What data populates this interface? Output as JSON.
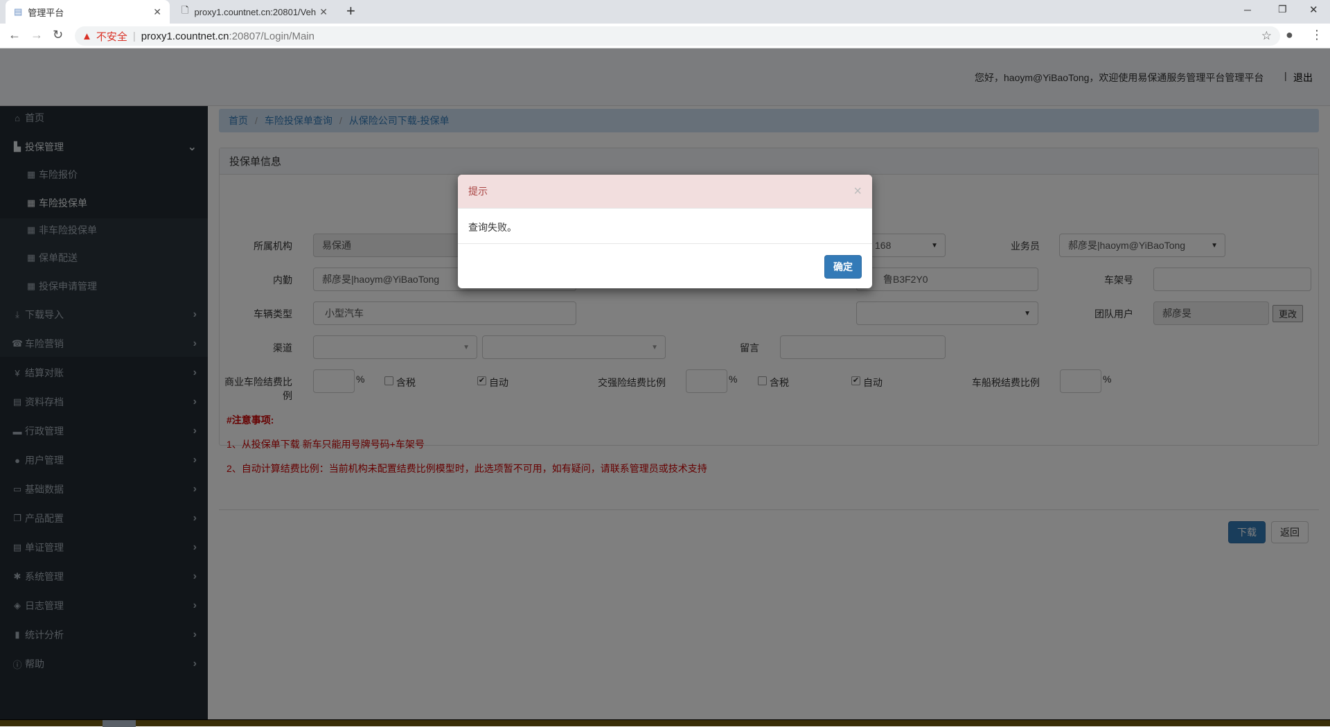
{
  "browser": {
    "tabs": [
      {
        "title": "管理平台",
        "active": true
      },
      {
        "title": "proxy1.countnet.cn:20801/Veh",
        "active": false
      }
    ],
    "security_label": "不安全",
    "url_host": "proxy1.countnet.cn",
    "url_rest": ":20807/Login/Main"
  },
  "header": {
    "welcome": "您好，haoym@YiBaoTong，欢迎使用易保通服务管理平台管理平台",
    "separator": "|",
    "logout": "退出"
  },
  "sidebar": {
    "items": [
      {
        "label": "首页",
        "icon": "home-icon"
      },
      {
        "label": "投保管理",
        "icon": "file-icon",
        "expanded": true,
        "children": [
          {
            "label": "车险报价"
          },
          {
            "label": "车险投保单",
            "active": true
          },
          {
            "label": "非车险投保单"
          },
          {
            "label": "保单配送"
          },
          {
            "label": "投保申请管理"
          }
        ]
      },
      {
        "label": "下载导入",
        "icon": "download-icon"
      },
      {
        "label": "车险营销",
        "icon": "phone-icon"
      },
      {
        "label": "结算对账",
        "icon": "yen-icon"
      },
      {
        "label": "资料存档",
        "icon": "list-icon"
      },
      {
        "label": "行政管理",
        "icon": "briefcase-icon"
      },
      {
        "label": "用户管理",
        "icon": "user-icon"
      },
      {
        "label": "基础数据",
        "icon": "hdd-icon"
      },
      {
        "label": "产品配置",
        "icon": "copy-icon"
      },
      {
        "label": "单证管理",
        "icon": "list-alt-icon"
      },
      {
        "label": "系统管理",
        "icon": "gear-icon"
      },
      {
        "label": "日志管理",
        "icon": "tags-icon"
      },
      {
        "label": "统计分析",
        "icon": "bar-chart-icon"
      },
      {
        "label": "帮助",
        "icon": "info-icon"
      }
    ]
  },
  "breadcrumb": [
    "首页",
    "车险投保单查询",
    "从保险公司下载-投保单"
  ],
  "panel": {
    "title": "投保单信息",
    "fields": {
      "org": {
        "label": "所属机构",
        "value": "易保通"
      },
      "partial_select": {
        "value": "168"
      },
      "salesman": {
        "label": "业务员",
        "value": "郝彦旻|haoym@YiBaoTong"
      },
      "internal": {
        "label": "内勤",
        "value": "郝彦旻|haoym@YiBaoTong"
      },
      "plate": {
        "value": "鲁B3F2Y0"
      },
      "vin": {
        "label": "车架号",
        "value": ""
      },
      "vehicle_type": {
        "label": "车辆类型",
        "value": "小型汽车"
      },
      "team_user": {
        "label": "团队用户",
        "value": "郝彦旻",
        "change_button": "更改"
      },
      "channel": {
        "label": "渠道",
        "value": ""
      },
      "remark": {
        "label": "留言",
        "value": ""
      },
      "commercial_ratio": {
        "label": "商业车险结费比例",
        "value": "",
        "unit": "%",
        "tax_label": "含税",
        "tax_checked": false,
        "auto_label": "自动",
        "auto_checked": true
      },
      "compulsory_ratio": {
        "label": "交强险结费比例",
        "value": "",
        "unit": "%",
        "tax_label": "含税",
        "tax_checked": false,
        "auto_label": "自动",
        "auto_checked": true
      },
      "vessel_tax_ratio": {
        "label": "车船税结费比例",
        "value": "",
        "unit": "%"
      }
    },
    "notes": {
      "title": "#注意事项:",
      "lines": [
        "1、从投保单下载 新车只能用号牌号码+车架号",
        "2、自动计算结费比例：当前机构未配置结费比例模型时，此选项暂不可用，如有疑问，请联系管理员或技术支持"
      ]
    }
  },
  "actions": {
    "download": "下载",
    "back": "返回"
  },
  "modal": {
    "title": "提示",
    "message": "查询失败。",
    "ok": "确定",
    "close": "×"
  },
  "colors": {
    "primary": "#337ab7",
    "modal_header": "#f2dede",
    "modal_title": "#a94442",
    "note": "#cc0000",
    "sidebar": "#222b33"
  }
}
